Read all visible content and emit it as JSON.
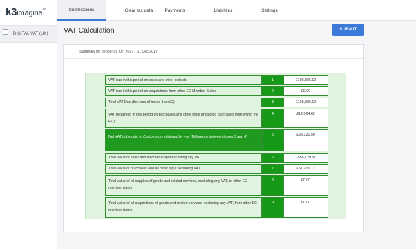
{
  "brand": {
    "k3": "k3",
    "imagine": "imagine",
    "rings": "∞"
  },
  "sidebar": {
    "items": [
      {
        "label": "DIGITAL VAT (UK)"
      }
    ]
  },
  "tabs": [
    {
      "label": "Submissions",
      "active": true
    },
    {
      "label": "Clear tax data",
      "active": false
    },
    {
      "label": "Payments",
      "active": false
    },
    {
      "label": "Liabilities",
      "active": false
    },
    {
      "label": "Settings",
      "active": false
    }
  ],
  "page": {
    "title": "VAT Calculation",
    "submit_label": "SUBMIT"
  },
  "summary": {
    "period": "Summary for period: 01 Oct 2017 - 31 Dec 2017"
  },
  "vat_rows": [
    {
      "description": "VAT due in this period on sales and other outputs",
      "box": "1",
      "value": "£108,386.12",
      "highlight": false
    },
    {
      "description": "VAT due in this period on acquisitions from other EC Member States",
      "box": "2",
      "value": "£0.00",
      "highlight": false
    },
    {
      "description": "Total VAT Due (the sum of boxes 1 and 2)",
      "box": "3",
      "value": "£108,386.12",
      "highlight": false
    },
    {
      "description": "VAT reclaimed in this period on purchases and other input (including purchases from within the EC)",
      "box": "4",
      "value": "£12,064.62",
      "highlight": false
    },
    {
      "description": "Net VAT to be paid to Customs or reclaimed by you (Difference between boxes 3 and 4)",
      "box": "5",
      "value": "£96,321.50",
      "highlight": true
    },
    {
      "description": "Total value of sales and all other output excluding any VAT",
      "box": "6",
      "value": "£556,120.51",
      "highlight": false
    },
    {
      "description": "Total value of purchases and all other input excluding VAT",
      "box": "7",
      "value": "£61,205.12",
      "highlight": false
    },
    {
      "description": "Total value of all supplies of goods and related services, excluding any VAT, to other EC member states",
      "box": "8",
      "value": "£0.00",
      "highlight": false
    },
    {
      "description": "Total value of all acquisitions of goods and related services, excluding any VAT, from other EC member states",
      "box": "9",
      "value": "£0.00",
      "highlight": false
    }
  ],
  "colors": {
    "accent_blue": "#3c7ad9",
    "box_green": "#169916",
    "highlight_green": "#1f9a1f",
    "panel_green": "#dff3df"
  }
}
